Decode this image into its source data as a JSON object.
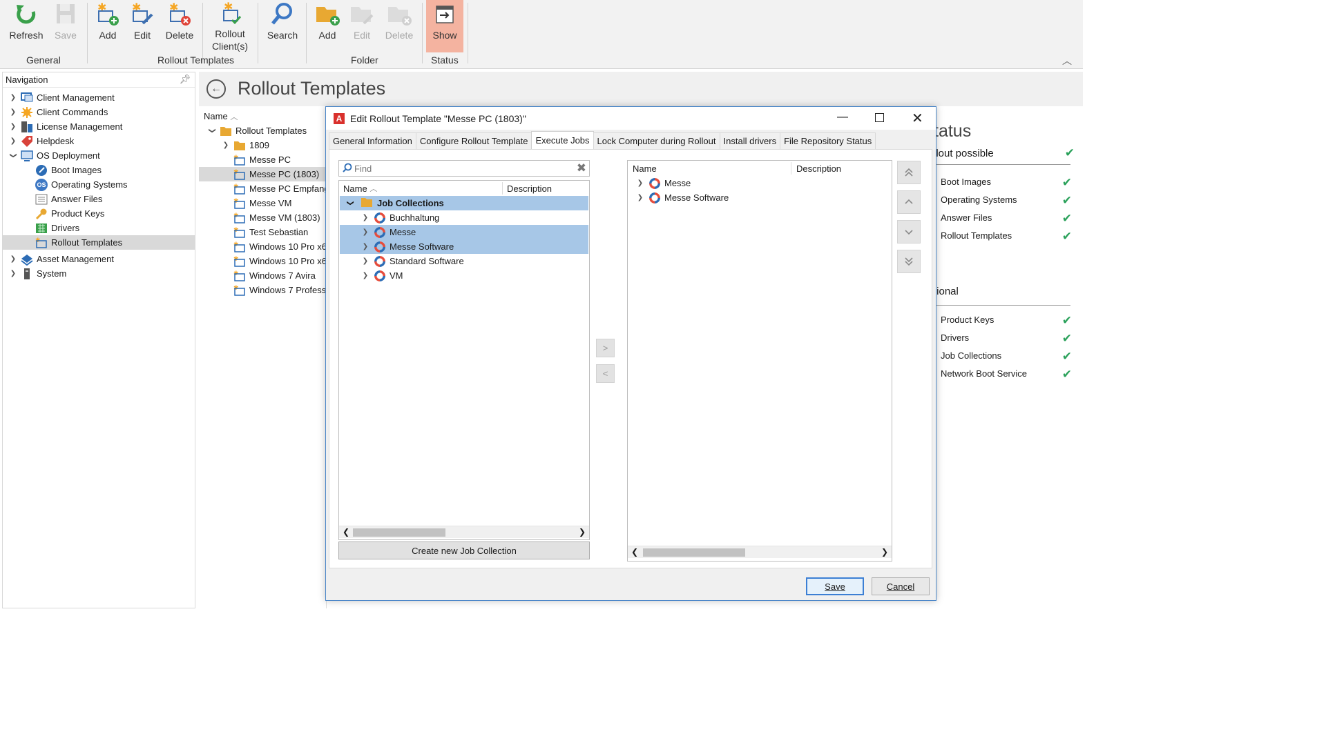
{
  "ribbon": {
    "general": {
      "label": "General",
      "refresh": "Refresh",
      "save": "Save"
    },
    "rollout_templates": {
      "label": "Rollout Templates",
      "add": "Add",
      "edit": "Edit",
      "delete": "Delete",
      "rollout_line1": "Rollout",
      "rollout_line2": "Client(s)",
      "search": "Search"
    },
    "folder": {
      "label": "Folder",
      "add": "Add",
      "edit": "Edit",
      "delete": "Delete"
    },
    "status": {
      "label": "Status",
      "show": "Show"
    }
  },
  "navigation": {
    "title": "Navigation",
    "items": [
      {
        "label": "Client Management",
        "icon": "client-management-icon"
      },
      {
        "label": "Client Commands",
        "icon": "client-commands-icon"
      },
      {
        "label": "License Management",
        "icon": "license-management-icon"
      },
      {
        "label": "Helpdesk",
        "icon": "helpdesk-icon"
      },
      {
        "label": "OS Deployment",
        "icon": "os-deployment-icon"
      },
      {
        "label": "Boot Images",
        "icon": "boot-images-icon"
      },
      {
        "label": "Operating Systems",
        "icon": "operating-systems-icon",
        "icon_text": "OS"
      },
      {
        "label": "Answer Files",
        "icon": "answer-files-icon"
      },
      {
        "label": "Product Keys",
        "icon": "product-keys-icon"
      },
      {
        "label": "Drivers",
        "icon": "drivers-icon"
      },
      {
        "label": "Rollout Templates",
        "icon": "rollout-templates-icon"
      },
      {
        "label": "Asset Management",
        "icon": "asset-management-icon"
      },
      {
        "label": "System",
        "icon": "system-icon"
      }
    ]
  },
  "main": {
    "title": "Rollout Templates",
    "list_header": "Name",
    "tree": {
      "root": "Rollout Templates",
      "items": [
        "1809",
        "Messe PC",
        "Messe PC (1803)",
        "Messe PC Empfang",
        "Messe VM",
        "Messe VM (1803)",
        "Test Sebastian",
        "Windows 10 Pro x6",
        "Windows 10 Pro x6",
        "Windows 7 Avira",
        "Windows 7 Profess"
      ]
    }
  },
  "status_panel": {
    "title": "tatus",
    "section1": "llout possible",
    "required": [
      "Boot Images",
      "Operating Systems",
      "Answer Files",
      "Rollout Templates"
    ],
    "section2": "tional",
    "optional": [
      "Product Keys",
      "Drivers",
      "Job Collections",
      "Network Boot Service"
    ],
    "check_color": "#2aa15a"
  },
  "dialog": {
    "title": "Edit Rollout Template \"Messe PC (1803)\"",
    "tabs": [
      "General Information",
      "Configure Rollout Template",
      "Execute Jobs",
      "Lock Computer during Rollout",
      "Install drivers",
      "File Repository Status"
    ],
    "active_tab": "Execute Jobs",
    "find_placeholder": "Find",
    "left_columns": {
      "name": "Name",
      "description": "Description"
    },
    "job_root": "Job Collections",
    "jobs": [
      "Buchhaltung",
      "Messe",
      "Messe Software",
      "Standard Software",
      "VM"
    ],
    "selected_jobs": [
      "Messe",
      "Messe Software"
    ],
    "create_button": "Create new Job Collection",
    "right_columns": {
      "name": "Name",
      "description": "Description"
    },
    "assigned": [
      "Messe",
      "Messe Software"
    ],
    "move_right": ">",
    "move_left": "<",
    "save": "Save",
    "cancel": "Cancel",
    "accent": "#4a86c8",
    "selection": "#a7c7e7"
  }
}
